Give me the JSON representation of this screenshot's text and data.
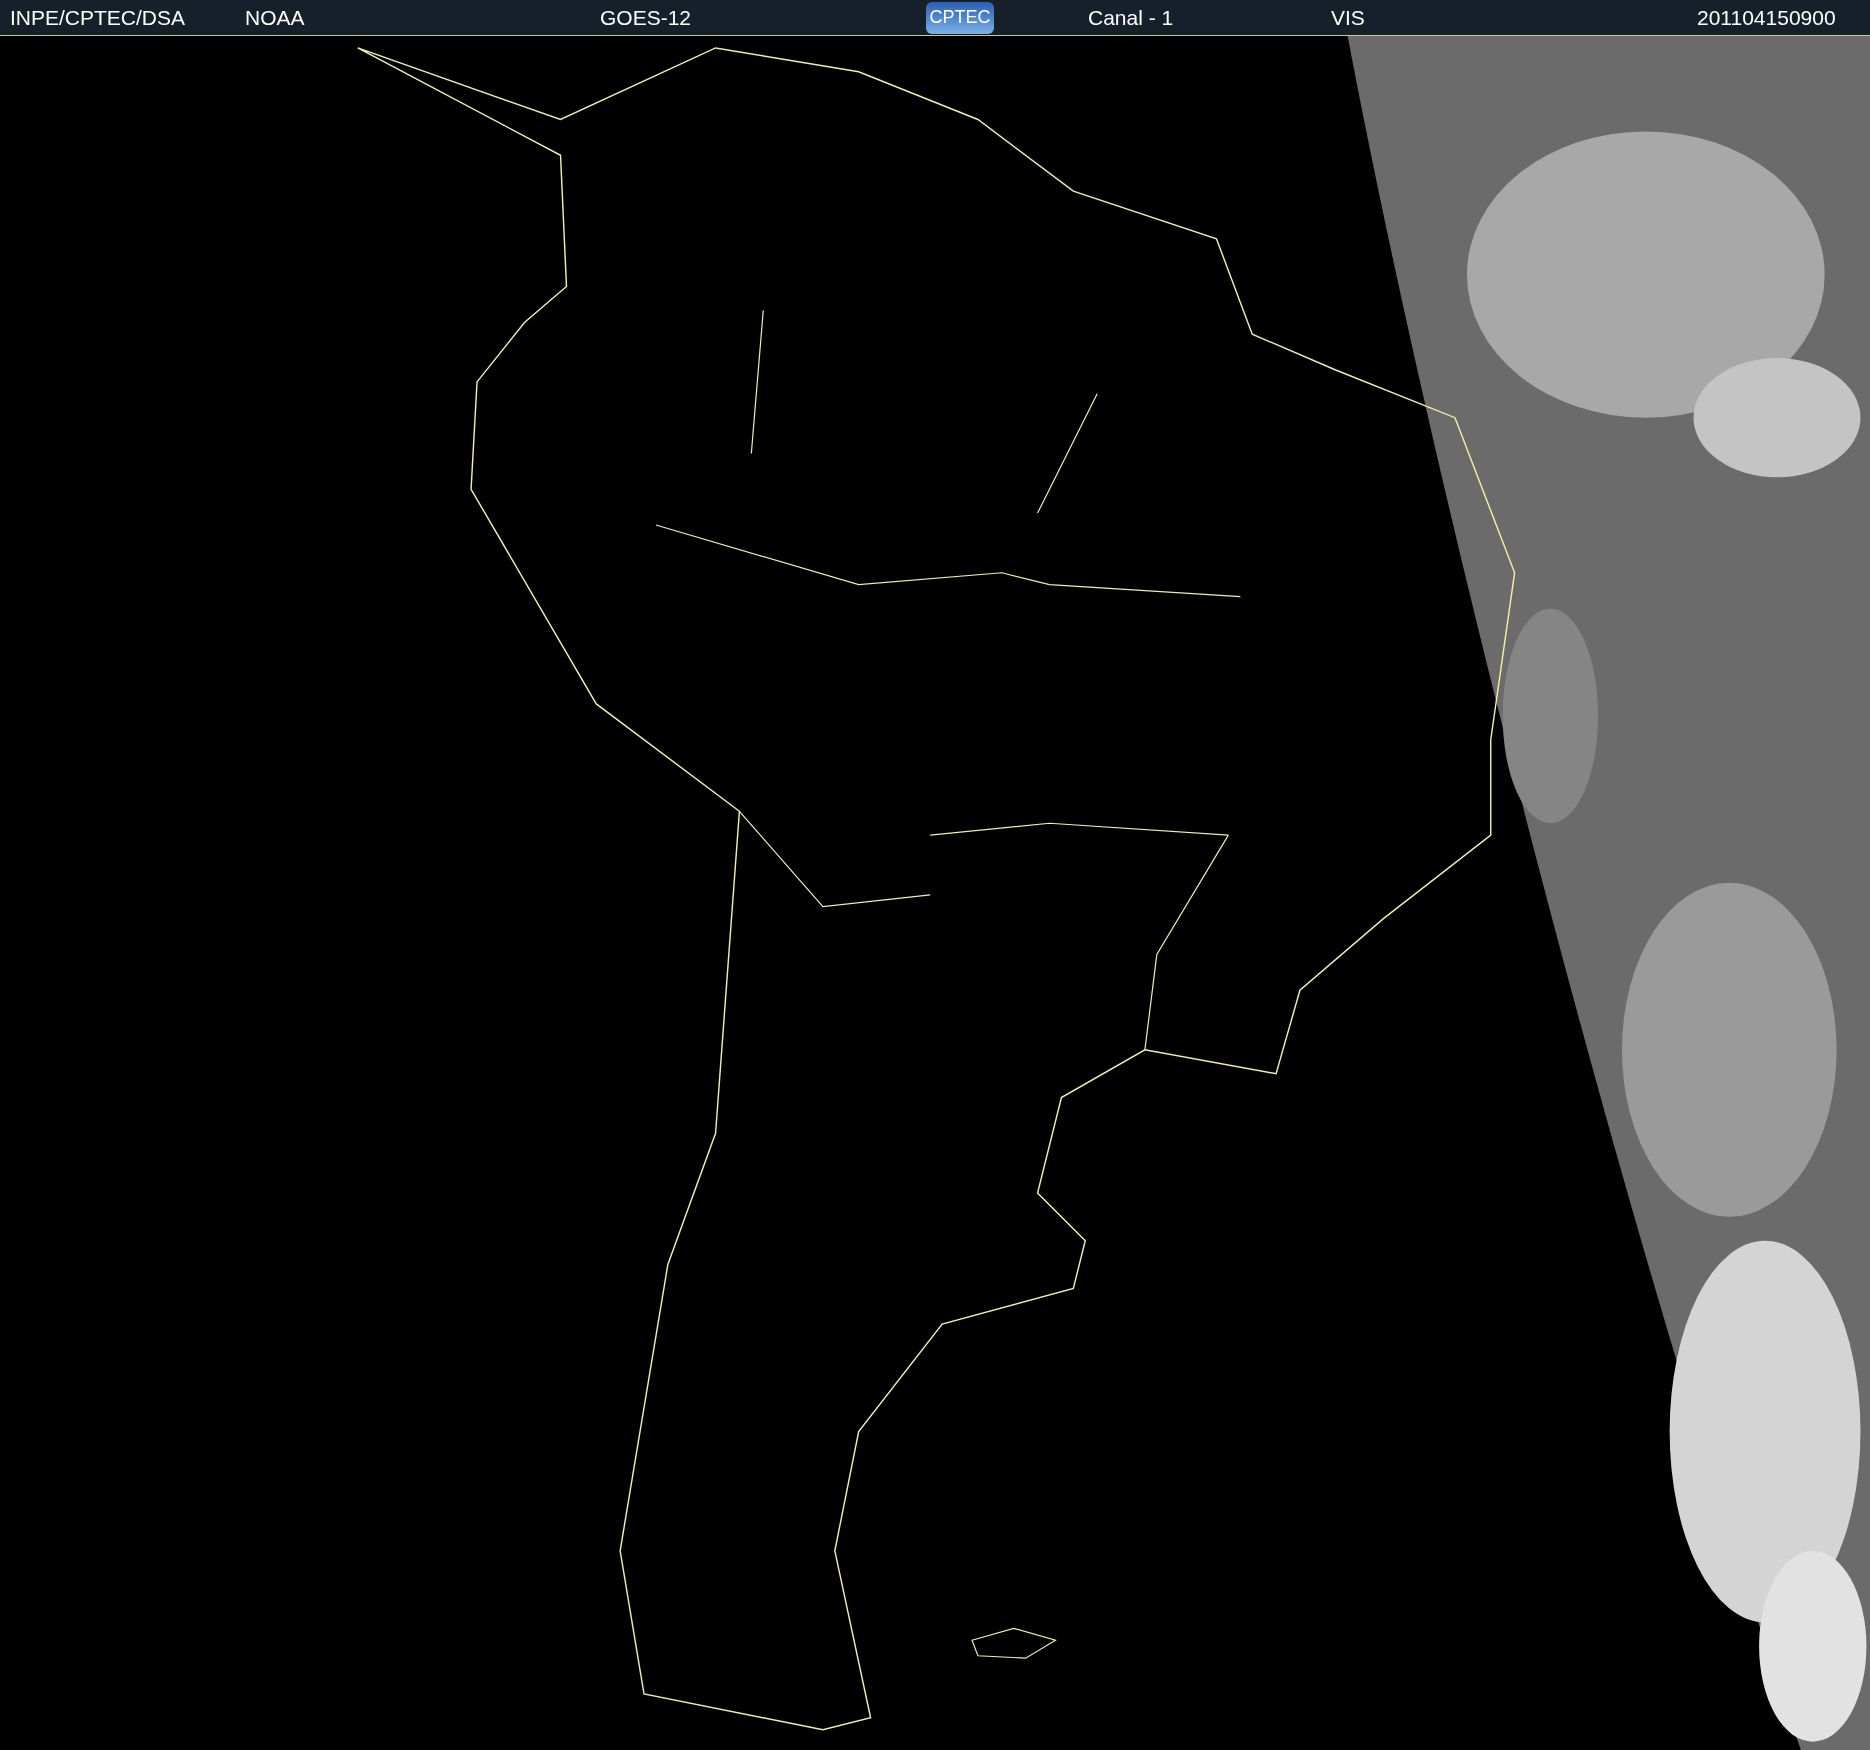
{
  "header": {
    "source": "INPE/CPTEC/DSA",
    "agency": "NOAA",
    "satellite": "GOES-12",
    "logo": "CPTEC",
    "channel": "Canal - 1",
    "band": "VIS",
    "timestamp": "201104150900"
  }
}
